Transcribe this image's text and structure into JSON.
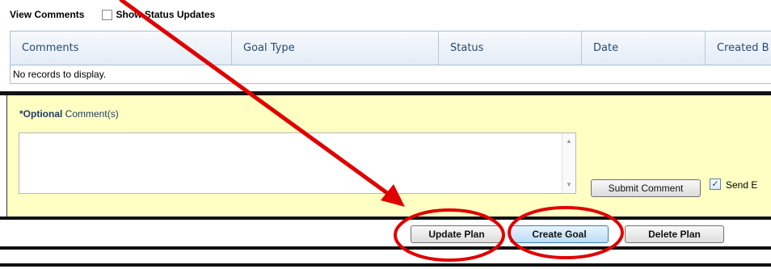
{
  "comments_section": {
    "title": "View Comments",
    "show_status_updates_label": "Show Status Updates",
    "show_status_updates_checked": false
  },
  "grid": {
    "columns": [
      "Comments",
      "Goal Type",
      "Status",
      "Date",
      "Created B"
    ],
    "empty_message": "No records to display."
  },
  "comment_form": {
    "required_marker": "*Optional",
    "label": " Comment(s)",
    "textarea_value": "",
    "submit_label": "Submit Comment",
    "send_email_label": "Send E",
    "send_email_checked": true
  },
  "actions": {
    "update_plan": "Update Plan",
    "create_goal": "Create Goal",
    "delete_plan": "Delete Plan"
  },
  "annotations": {
    "arrow_color": "#e00000",
    "circle_color": "#e00000"
  }
}
